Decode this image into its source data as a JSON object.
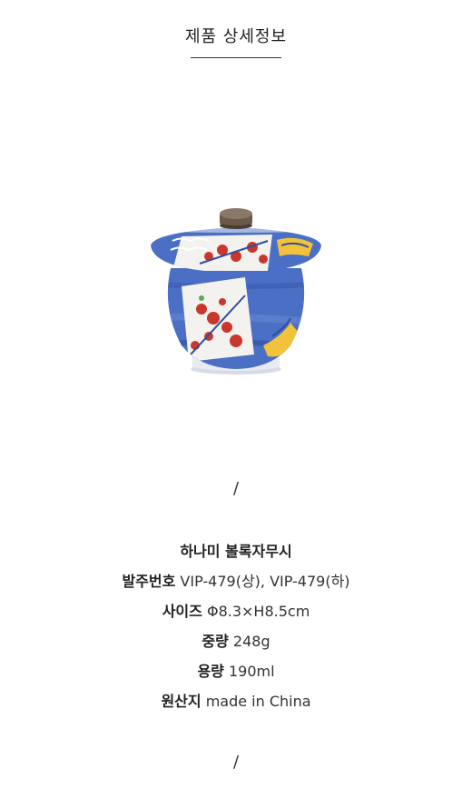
{
  "header": {
    "title": "제품 상세정보"
  },
  "product_image": {
    "alt": "하나미 볼록자무시"
  },
  "divider_top": "/",
  "specs": {
    "name": "하나미 볼록자무시",
    "rows": [
      {
        "label": "발주번호",
        "value": "VIP-479(상), VIP-479(하)"
      },
      {
        "label": "사이즈",
        "value": "Φ8.3×H8.5cm"
      },
      {
        "label": "중량",
        "value": "248g"
      },
      {
        "label": "용량",
        "value": "190ml"
      },
      {
        "label": "원산지",
        "value": "made in China"
      }
    ]
  },
  "divider_bottom": "/",
  "colors": {
    "porcelain_blue": "#4a6fc4",
    "porcelain_dark_blue": "#2e4f9e",
    "flower_red": "#c8372d",
    "accent_yellow": "#f2c23a",
    "lid_knob": "#6b5a4a"
  }
}
